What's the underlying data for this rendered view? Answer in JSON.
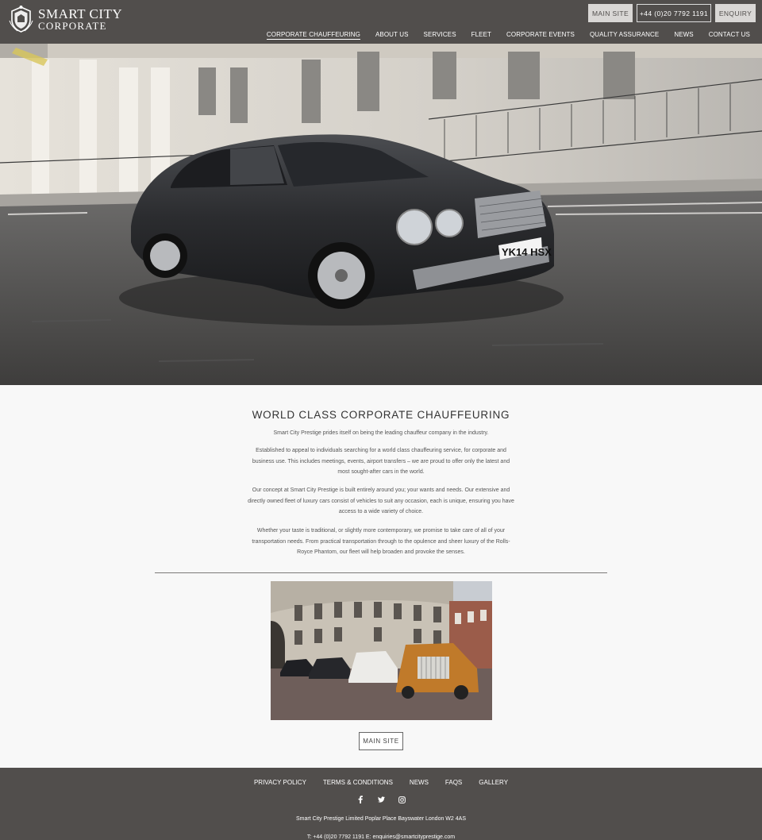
{
  "header": {
    "logo_line1": "SMART CITY",
    "logo_line2": "CORPORATE",
    "buttons": {
      "main_site": "MAIN SITE",
      "phone": "+44 (0)20 7792 1191",
      "enquiry": "ENQUIRY"
    },
    "nav": [
      {
        "label": "CORPORATE CHAUFFEURING",
        "active": true
      },
      {
        "label": "ABOUT US"
      },
      {
        "label": "SERVICES"
      },
      {
        "label": "FLEET"
      },
      {
        "label": "CORPORATE EVENTS"
      },
      {
        "label": "QUALITY ASSURANCE"
      },
      {
        "label": "NEWS"
      },
      {
        "label": "CONTACT US"
      }
    ]
  },
  "hero": {
    "plate": "YK14 HSX"
  },
  "main": {
    "title": "WORLD CLASS CORPORATE CHAUFFEURING",
    "paragraphs": [
      "Smart City Prestige prides itself on being the leading chauffeur company in the industry.",
      "Established to appeal to individuals searching for a world class chauffeuring service, for corporate and business use. This includes meetings, events, airport transfers – we are proud to offer only the latest and most sought-after cars in the world.",
      "Our concept at Smart City Prestige is built entirely around you; your wants and needs. Our extensive and directly owned fleet of luxury cars consist of vehicles to suit any occasion, each is unique, ensuring you have access to a wide variety of choice.",
      "Whether your taste is traditional, or slightly more contemporary, we promise to take care of all of your transportation needs. From practical transportation through to the opulence and sheer luxury of the Rolls-Royce Phantom, our fleet will help broaden and provoke the senses."
    ],
    "main_site_button": "MAIN SITE"
  },
  "footer": {
    "links": [
      "PRIVACY POLICY",
      "TERMS & CONDITIONS",
      "NEWS",
      "FAQS",
      "GALLERY"
    ],
    "social_icons": [
      "facebook-icon",
      "twitter-icon",
      "instagram-icon"
    ],
    "address": "Smart City Prestige Limited  Poplar Place  Bayswater  London  W2 4AS",
    "contact": "T: +44 (0)20 7792 1191      E: enquiries@smartcityprestige.com"
  },
  "colors": {
    "header_bg": "#514e4c",
    "footer_bg": "#514e4c",
    "page_bg": "#f8f8f8"
  }
}
